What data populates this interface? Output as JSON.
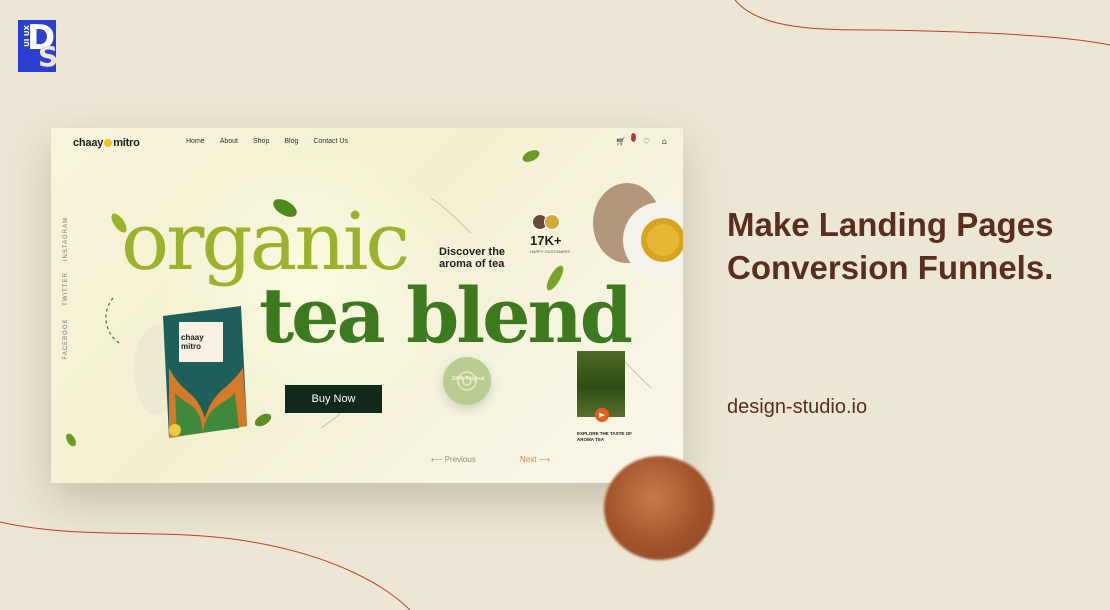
{
  "logo": {
    "letters_top": "D",
    "letters_bottom": "S",
    "side_text": "UI UX"
  },
  "mockup": {
    "brand": {
      "part1": "chaay",
      "part2": "mitro"
    },
    "nav": [
      {
        "label": "Home"
      },
      {
        "label": "About"
      },
      {
        "label": "Shop"
      },
      {
        "label": "Blog"
      },
      {
        "label": "Contact Us"
      }
    ],
    "cart_count": "2",
    "social": {
      "instagram": "INSTAGRAM",
      "twitter": "TWITTER",
      "facebook": "FACEBOOK"
    },
    "headline_line1": "organic",
    "headline_line2": "tea blend",
    "discover": "Discover the aroma of tea",
    "stat_value": "17K+",
    "stat_label": "HAPPY CUSTOMERS",
    "package": {
      "brand1": "chaay",
      "brand2": "mitro"
    },
    "buy_label": "Buy Now",
    "seal_text": "100% Original",
    "explore_text": "EXPLORE THE TASTE OF AROMA TEA",
    "previous_label": "Previous",
    "next_label": "Next"
  },
  "tagline": "Make Landing Pages Conversion Funnels.",
  "url": "design-studio.io",
  "icons": [
    "cart-icon",
    "heart-icon",
    "user-icon",
    "play-icon",
    "arrow-left-icon",
    "arrow-right-icon"
  ],
  "colors": {
    "background": "#ece6d4",
    "tagline": "#5b2d1f",
    "olive": "#9bb22c",
    "green": "#3d7a1f",
    "button": "#0f2a1a",
    "accent": "#e85d19",
    "logo": "#2b3fd0"
  }
}
